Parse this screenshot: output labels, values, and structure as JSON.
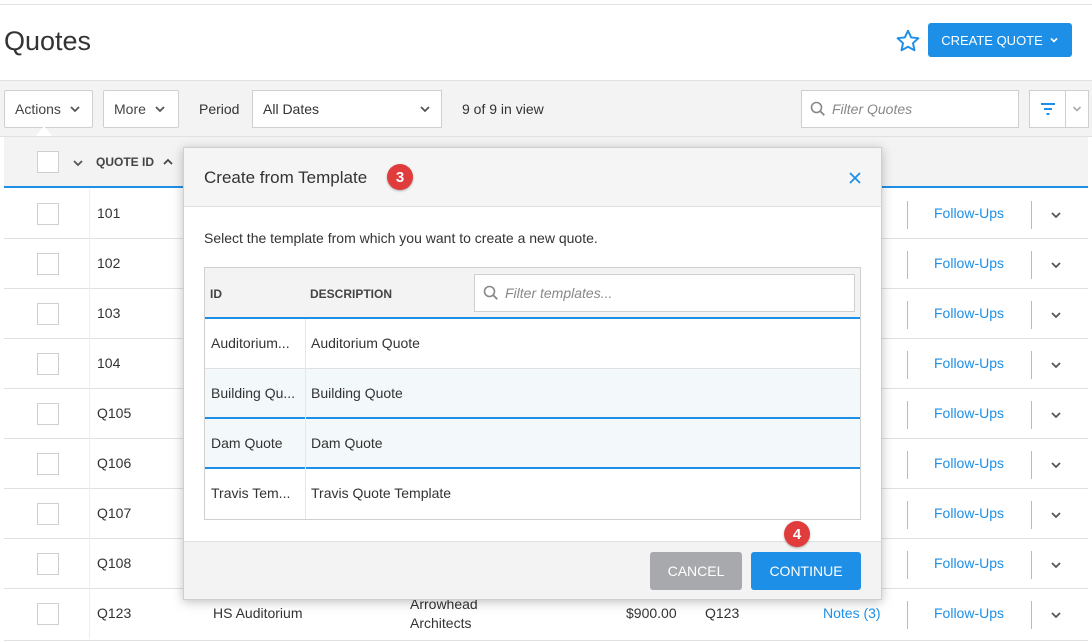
{
  "page": {
    "title": "Quotes"
  },
  "header": {
    "create_button_label": "CREATE QUOTE",
    "favorite_icon": "star-icon",
    "accent_color": "#1e8fe6"
  },
  "toolbar": {
    "actions_label": "Actions",
    "more_label": "More",
    "period_label": "Period",
    "period_value": "All Dates",
    "view_count": "9 of 9 in view",
    "filter_placeholder": "Filter Quotes"
  },
  "table": {
    "header": {
      "quote_id": "QUOTE ID"
    },
    "followups_label": "Follow-Ups",
    "rows": [
      {
        "id": "101"
      },
      {
        "id": "102"
      },
      {
        "id": "103"
      },
      {
        "id": "104"
      },
      {
        "id": "Q105"
      },
      {
        "id": "Q106"
      },
      {
        "id": "Q107"
      },
      {
        "id": "Q108"
      },
      {
        "id": "Q123",
        "name": "HS Auditorium",
        "company_line1": "Arrowhead",
        "company_line2": "Architects",
        "amount": "$900.00",
        "ref": "Q123",
        "notes": "Notes (3)"
      }
    ]
  },
  "modal": {
    "title": "Create from Template",
    "description": "Select the template from which you want to create a new quote.",
    "columns": {
      "id": "ID",
      "description": "DESCRIPTION"
    },
    "filter_placeholder": "Filter templates...",
    "templates": [
      {
        "id": "Auditorium...",
        "description": "Auditorium Quote"
      },
      {
        "id": "Building Qu...",
        "description": "Building Quote"
      },
      {
        "id": "Dam Quote",
        "description": "Dam Quote"
      },
      {
        "id": "Travis Tem...",
        "description": "Travis Quote Template"
      }
    ],
    "cancel_label": "CANCEL",
    "continue_label": "CONTINUE"
  },
  "callouts": {
    "step_title": "3",
    "step_continue": "4",
    "badge_color": "#e03c3c"
  }
}
